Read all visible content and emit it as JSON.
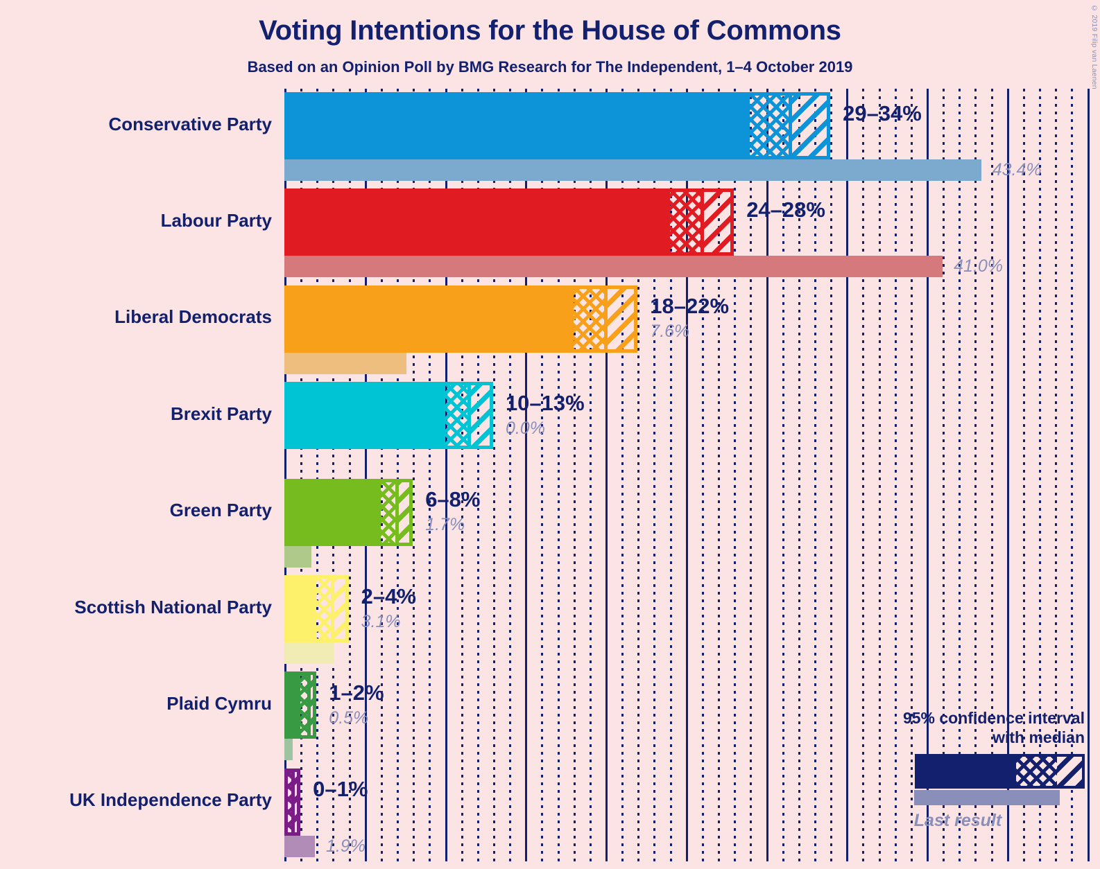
{
  "header": {
    "title": "Voting Intentions for the House of Commons",
    "subtitle": "Based on an Opinion Poll by BMG Research for The Independent, 1–4 October 2019"
  },
  "copyright": "© 2019 Filip van Laenen",
  "legend": {
    "ci_text": "95% confidence interval\nwith median",
    "last_result_label": "Last result"
  },
  "colors": {
    "background": "#fce4e4",
    "navy": "#12206e",
    "muted": "#8a8fb9"
  },
  "chart_data": {
    "type": "bar",
    "title": "Voting Intentions for the House of Commons",
    "subtitle": "Based on an Opinion Poll by BMG Research for The Independent, 1–4 October 2019",
    "xlabel": "",
    "ylabel": "",
    "xlim": [
      0,
      50
    ],
    "grid": true,
    "grid_major_step": 5,
    "grid_minor_step": 1,
    "legend_position": "bottom-right",
    "value_unit": "%",
    "categories": [
      "Conservative Party",
      "Labour Party",
      "Liberal Democrats",
      "Brexit Party",
      "Green Party",
      "Scottish National Party",
      "Plaid Cymru",
      "UK Independence Party"
    ],
    "series": [
      {
        "name": "95% confidence interval with median",
        "values": [
          {
            "low": 29,
            "median": 31.5,
            "high": 34
          },
          {
            "low": 24,
            "median": 26,
            "high": 28
          },
          {
            "low": 18,
            "median": 20,
            "high": 22
          },
          {
            "low": 10,
            "median": 11.5,
            "high": 13
          },
          {
            "low": 6,
            "median": 7,
            "high": 8
          },
          {
            "low": 2,
            "median": 3,
            "high": 4
          },
          {
            "low": 1,
            "median": 1.5,
            "high": 2
          },
          {
            "low": 0,
            "median": 0.5,
            "high": 1
          }
        ]
      },
      {
        "name": "Last result",
        "values": [
          43.4,
          41.0,
          7.6,
          0.0,
          1.7,
          3.1,
          0.5,
          1.9
        ]
      }
    ],
    "rows": [
      {
        "party": "Conservative Party",
        "range_label": "29–34%",
        "last_result_label": "43.4%",
        "low": 29,
        "median": 31.5,
        "high": 34,
        "last_result": 43.4,
        "color": "#0d93d8",
        "last_color": "#7baace"
      },
      {
        "party": "Labour Party",
        "range_label": "24–28%",
        "last_result_label": "41.0%",
        "low": 24,
        "median": 26,
        "high": 28,
        "last_result": 41.0,
        "color": "#e01b22",
        "last_color": "#d5797c"
      },
      {
        "party": "Liberal Democrats",
        "range_label": "18–22%",
        "last_result_label": "7.6%",
        "low": 18,
        "median": 20,
        "high": 22,
        "last_result": 7.6,
        "color": "#f9a01b",
        "last_color": "#edbe7e"
      },
      {
        "party": "Brexit Party",
        "range_label": "10–13%",
        "last_result_label": "0.0%",
        "low": 10,
        "median": 11.5,
        "high": 13,
        "last_result": 0.0,
        "color": "#00c3d4",
        "last_color": "#8fd5dd"
      },
      {
        "party": "Green Party",
        "range_label": "6–8%",
        "last_result_label": "1.7%",
        "low": 6,
        "median": 7,
        "high": 8,
        "last_result": 1.7,
        "color": "#77bc1f",
        "last_color": "#aec98a"
      },
      {
        "party": "Scottish National Party",
        "range_label": "2–4%",
        "last_result_label": "3.1%",
        "low": 2,
        "median": 3,
        "high": 4,
        "last_result": 3.1,
        "color": "#fdf06a",
        "last_color": "#f0ecb4"
      },
      {
        "party": "Plaid Cymru",
        "range_label": "1–2%",
        "last_result_label": "0.5%",
        "low": 1,
        "median": 1.5,
        "high": 2,
        "last_result": 0.5,
        "color": "#389b44",
        "last_color": "#9dc3a0"
      },
      {
        "party": "UK Independence Party",
        "range_label": "0–1%",
        "last_result_label": "1.9%",
        "low": 0,
        "median": 0.5,
        "high": 1,
        "last_result": 1.9,
        "color": "#7b1d86",
        "last_color": "#b08cb6"
      }
    ]
  }
}
